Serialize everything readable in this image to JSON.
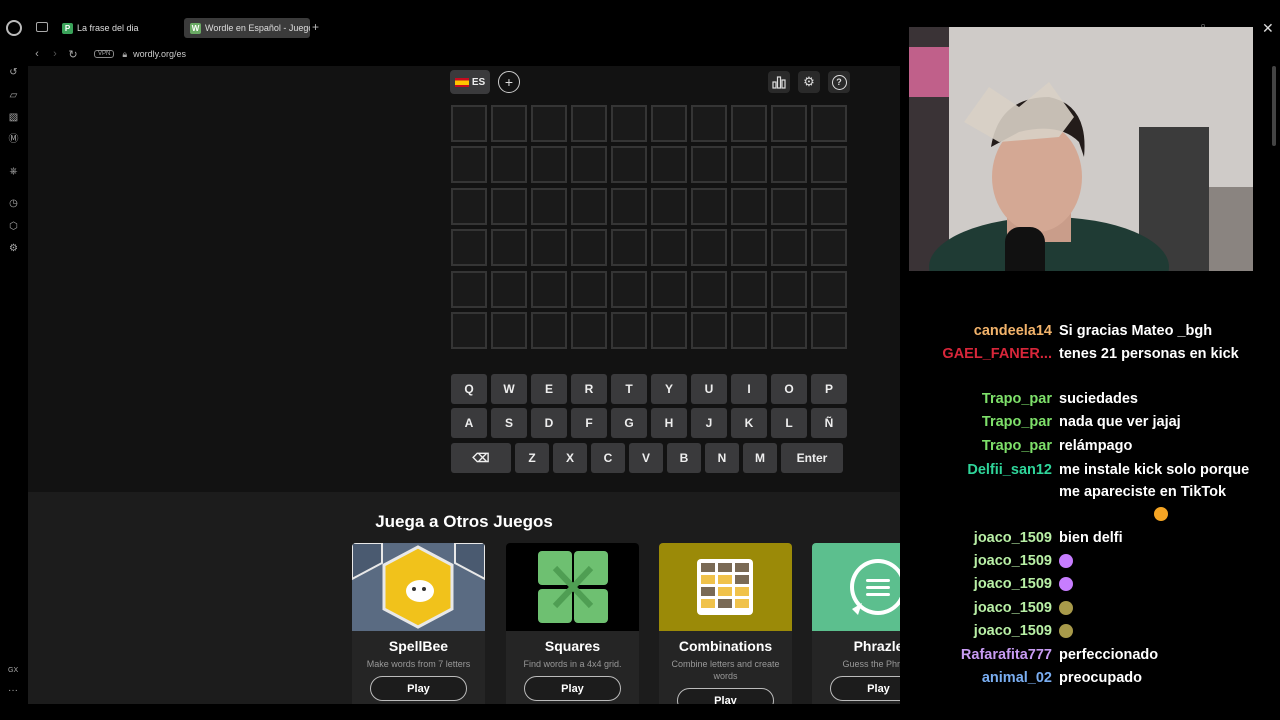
{
  "browser": {
    "tabs": [
      {
        "label": "La frase del dia",
        "favicon": "P"
      },
      {
        "label": "Wordle en Español - Juego",
        "favicon": "W"
      }
    ],
    "new_tab": "+",
    "url": "wordly.org/es",
    "vpn": "VPN",
    "sidebar_gx": "GX",
    "sidebar_more": "···"
  },
  "page": {
    "language": "ES",
    "keyboard": {
      "row1": [
        "Q",
        "W",
        "E",
        "R",
        "T",
        "Y",
        "U",
        "I",
        "O",
        "P"
      ],
      "row2": [
        "A",
        "S",
        "D",
        "F",
        "G",
        "H",
        "J",
        "K",
        "L",
        "Ñ"
      ],
      "row3": [
        "Z",
        "X",
        "C",
        "V",
        "B",
        "N",
        "M"
      ],
      "enter": "Enter",
      "backspace": "⌫"
    },
    "games_title": "Juega a Otros Juegos",
    "games": [
      {
        "name": "SpellBee",
        "desc": "Make words from 7 letters",
        "play": "Play"
      },
      {
        "name": "Squares",
        "desc": "Find words in a 4x4 grid.",
        "play": "Play"
      },
      {
        "name": "Combinations",
        "desc": "Combine letters and create words",
        "play": "Play"
      },
      {
        "name": "Phrazle",
        "desc": "Guess the Phrase",
        "play": "Play"
      }
    ]
  },
  "chat": [
    {
      "user": "candeela14",
      "color": "#f2b36b",
      "text": "Si gracias Mateo _bgh"
    },
    {
      "user": "GAEL_FANER...",
      "color": "#d8263a",
      "text": "tenes 21 personas en kick"
    },
    {
      "user": "Trapo_par",
      "color": "#7ee06a",
      "text": "suciedades"
    },
    {
      "user": "Trapo_par",
      "color": "#7ee06a",
      "text": "nada que ver jajaj"
    },
    {
      "user": "Trapo_par",
      "color": "#7ee06a",
      "text": "relámpago"
    },
    {
      "user": "Delfii_san12",
      "color": "#2fd59a",
      "text": "me instale kick solo porque me apareciste en TikTok"
    },
    {
      "user": "joaco_1509",
      "color": "#b9f0a6",
      "text": "bien delfi"
    },
    {
      "user": "joaco_1509",
      "color": "#b9f0a6",
      "text": ""
    },
    {
      "user": "joaco_1509",
      "color": "#b9f0a6",
      "text": ""
    },
    {
      "user": "joaco_1509",
      "color": "#b9f0a6",
      "text": ""
    },
    {
      "user": "joaco_1509",
      "color": "#b9f0a6",
      "text": ""
    },
    {
      "user": "Rafarafita777",
      "color": "#c79bf2",
      "text": "perfeccionado"
    },
    {
      "user": "animal_02",
      "color": "#7aaef2",
      "text": "preocupado"
    }
  ]
}
